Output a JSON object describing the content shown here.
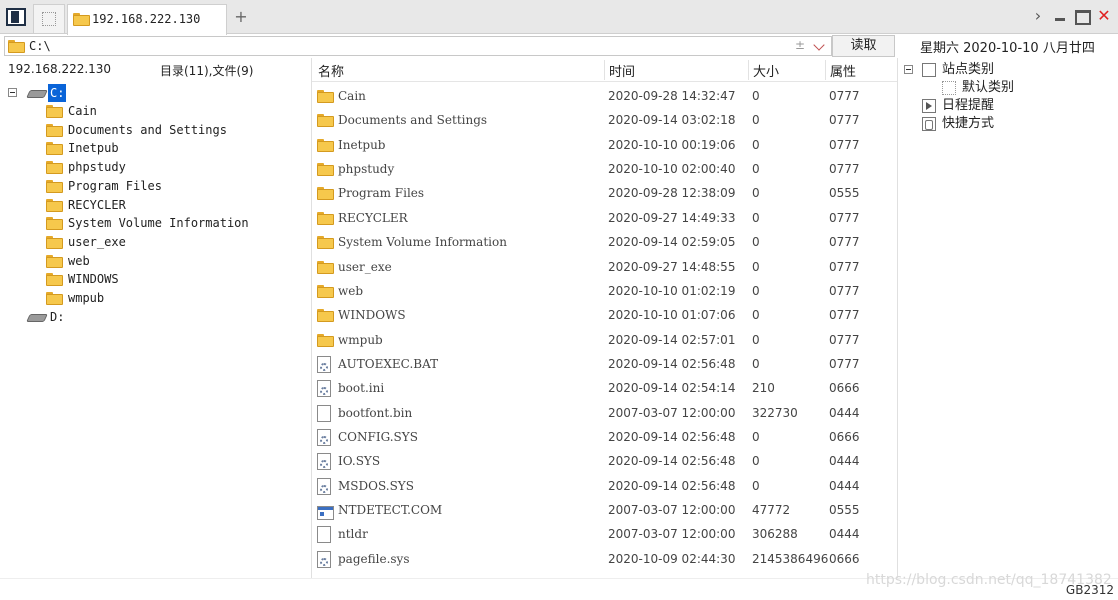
{
  "tab": {
    "title": "192.168.222.130",
    "add_label": "+"
  },
  "window": {
    "forward_label": "›",
    "close_label": "✕"
  },
  "address": {
    "path": "C:\\",
    "plus_minus": "±",
    "read_label": "读取"
  },
  "date_info": "星期六 2020-10-10 八月廿四",
  "left": {
    "host": "192.168.222.130",
    "counts": "目录(11),文件(9)",
    "drives": [
      {
        "label": "C:",
        "selected": true
      },
      {
        "label": "D:",
        "selected": false
      }
    ],
    "folders": [
      "Cain",
      "Documents and Settings",
      "Inetpub",
      "phpstudy",
      "Program Files",
      "RECYCLER",
      "System Volume Information",
      "user_exe",
      "web",
      "WINDOWS",
      "wmpub"
    ]
  },
  "columns": {
    "name": "名称",
    "time": "时间",
    "size": "大小",
    "attr": "属性"
  },
  "files": [
    {
      "name": "Cain",
      "time": "2020-09-28 14:32:47",
      "size": "0",
      "attr": "0777",
      "icon": "folder-icon"
    },
    {
      "name": "Documents and Settings",
      "time": "2020-09-14 03:02:18",
      "size": "0",
      "attr": "0777",
      "icon": "folder-icon"
    },
    {
      "name": "Inetpub",
      "time": "2020-10-10 00:19:06",
      "size": "0",
      "attr": "0777",
      "icon": "folder-icon"
    },
    {
      "name": "phpstudy",
      "time": "2020-10-10 02:00:40",
      "size": "0",
      "attr": "0777",
      "icon": "folder-icon"
    },
    {
      "name": "Program Files",
      "time": "2020-09-28 12:38:09",
      "size": "0",
      "attr": "0555",
      "icon": "folder-icon"
    },
    {
      "name": "RECYCLER",
      "time": "2020-09-27 14:49:33",
      "size": "0",
      "attr": "0777",
      "icon": "folder-icon"
    },
    {
      "name": "System Volume Information",
      "time": "2020-09-14 02:59:05",
      "size": "0",
      "attr": "0777",
      "icon": "folder-icon"
    },
    {
      "name": "user_exe",
      "time": "2020-09-27 14:48:55",
      "size": "0",
      "attr": "0777",
      "icon": "folder-icon"
    },
    {
      "name": "web",
      "time": "2020-10-10 01:02:19",
      "size": "0",
      "attr": "0777",
      "icon": "folder-icon"
    },
    {
      "name": "WINDOWS",
      "time": "2020-10-10 01:07:06",
      "size": "0",
      "attr": "0777",
      "icon": "folder-icon"
    },
    {
      "name": "wmpub",
      "time": "2020-09-14 02:57:01",
      "size": "0",
      "attr": "0777",
      "icon": "folder-icon"
    },
    {
      "name": "AUTOEXEC.BAT",
      "time": "2020-09-14 02:56:48",
      "size": "0",
      "attr": "0777",
      "icon": "gear-file-icon"
    },
    {
      "name": "boot.ini",
      "time": "2020-09-14 02:54:14",
      "size": "210",
      "attr": "0666",
      "icon": "gear-file-icon"
    },
    {
      "name": "bootfont.bin",
      "time": "2007-03-07 12:00:00",
      "size": "322730",
      "attr": "0444",
      "icon": "blank-file-icon"
    },
    {
      "name": "CONFIG.SYS",
      "time": "2020-09-14 02:56:48",
      "size": "0",
      "attr": "0666",
      "icon": "gear-file-icon"
    },
    {
      "name": "IO.SYS",
      "time": "2020-09-14 02:56:48",
      "size": "0",
      "attr": "0444",
      "icon": "gear-file-icon"
    },
    {
      "name": "MSDOS.SYS",
      "time": "2020-09-14 02:56:48",
      "size": "0",
      "attr": "0444",
      "icon": "gear-file-icon"
    },
    {
      "name": "NTDETECT.COM",
      "time": "2007-03-07 12:00:00",
      "size": "47772",
      "attr": "0555",
      "icon": "exe-file-icon"
    },
    {
      "name": "ntldr",
      "time": "2007-03-07 12:00:00",
      "size": "306288",
      "attr": "0444",
      "icon": "blank-file-icon"
    },
    {
      "name": "pagefile.sys",
      "time": "2020-10-09 02:44:30",
      "size": "2145386496",
      "attr": "0666",
      "icon": "gear-file-icon"
    }
  ],
  "right": {
    "items": [
      {
        "label": "站点类别",
        "icon": "category-icon"
      },
      {
        "label": "默认类别",
        "icon": "default-category-icon"
      },
      {
        "label": "日程提醒",
        "icon": "schedule-icon"
      },
      {
        "label": "快捷方式",
        "icon": "shortcut-icon"
      }
    ]
  },
  "watermark": "https://blog.csdn.net/qq_18741382",
  "status_code": "GB2312",
  "colors": {
    "selection": "#0a64d8",
    "folder": "#f6c84c",
    "close": "#e02020"
  }
}
